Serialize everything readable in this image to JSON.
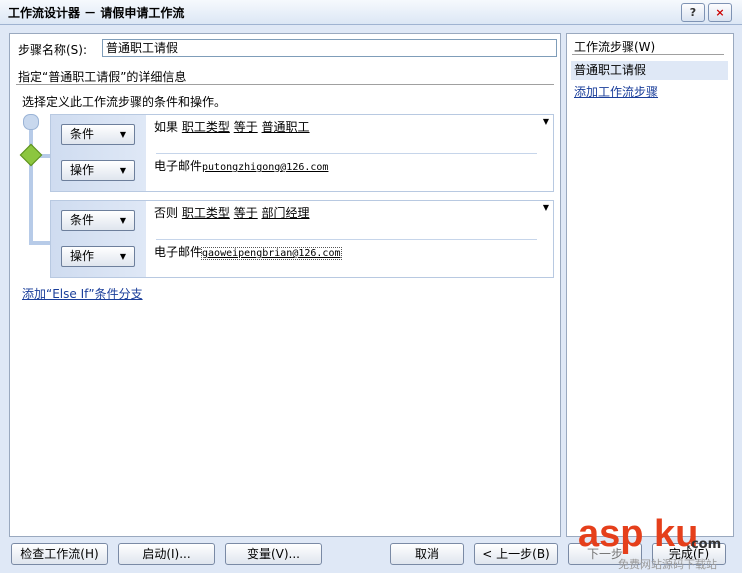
{
  "window": {
    "title": "工作流设计器 － 请假申请工作流",
    "help_btn": "?",
    "close_btn": "×"
  },
  "step": {
    "name_label": "步骤名称(S):",
    "name_value": "普通职工请假",
    "details_header": "指定“普通职工请假”的详细信息",
    "instruction": "选择定义此工作流步骤的条件和操作。"
  },
  "blocks": [
    {
      "condition_btn": "条件",
      "action_btn": "操作",
      "cond_keyword": "如果",
      "cond_field": "职工类型",
      "cond_op": "等于",
      "cond_value": "普通职工",
      "action_label": "电子邮件",
      "action_email": "putongzhigong@126.com"
    },
    {
      "condition_btn": "条件",
      "action_btn": "操作",
      "cond_keyword": "否则",
      "cond_field": "职工类型",
      "cond_op": "等于",
      "cond_value": "部门经理",
      "action_label": "电子邮件",
      "action_email": "gaoweipengbrian@126.com"
    }
  ],
  "add_else_if": "添加“Else If”条件分支",
  "sidebar": {
    "header": "工作流步骤(W)",
    "items": [
      "普通职工请假"
    ],
    "add_link": "添加工作流步骤"
  },
  "buttons": {
    "check": "检查工作流(H)",
    "start": "启动(I)...",
    "variables": "变量(V)...",
    "cancel": "取消",
    "back": "< 上一步(B)",
    "next": "下一步",
    "finish": "完成(F)"
  },
  "watermark": {
    "brand": "asp ku",
    "domain": ".com",
    "tagline": "免费网站源码下载站"
  },
  "colors": {
    "connector": "#b7cbe8",
    "diamond": "#8cc63f",
    "link_blue": "#1a3e9a"
  }
}
